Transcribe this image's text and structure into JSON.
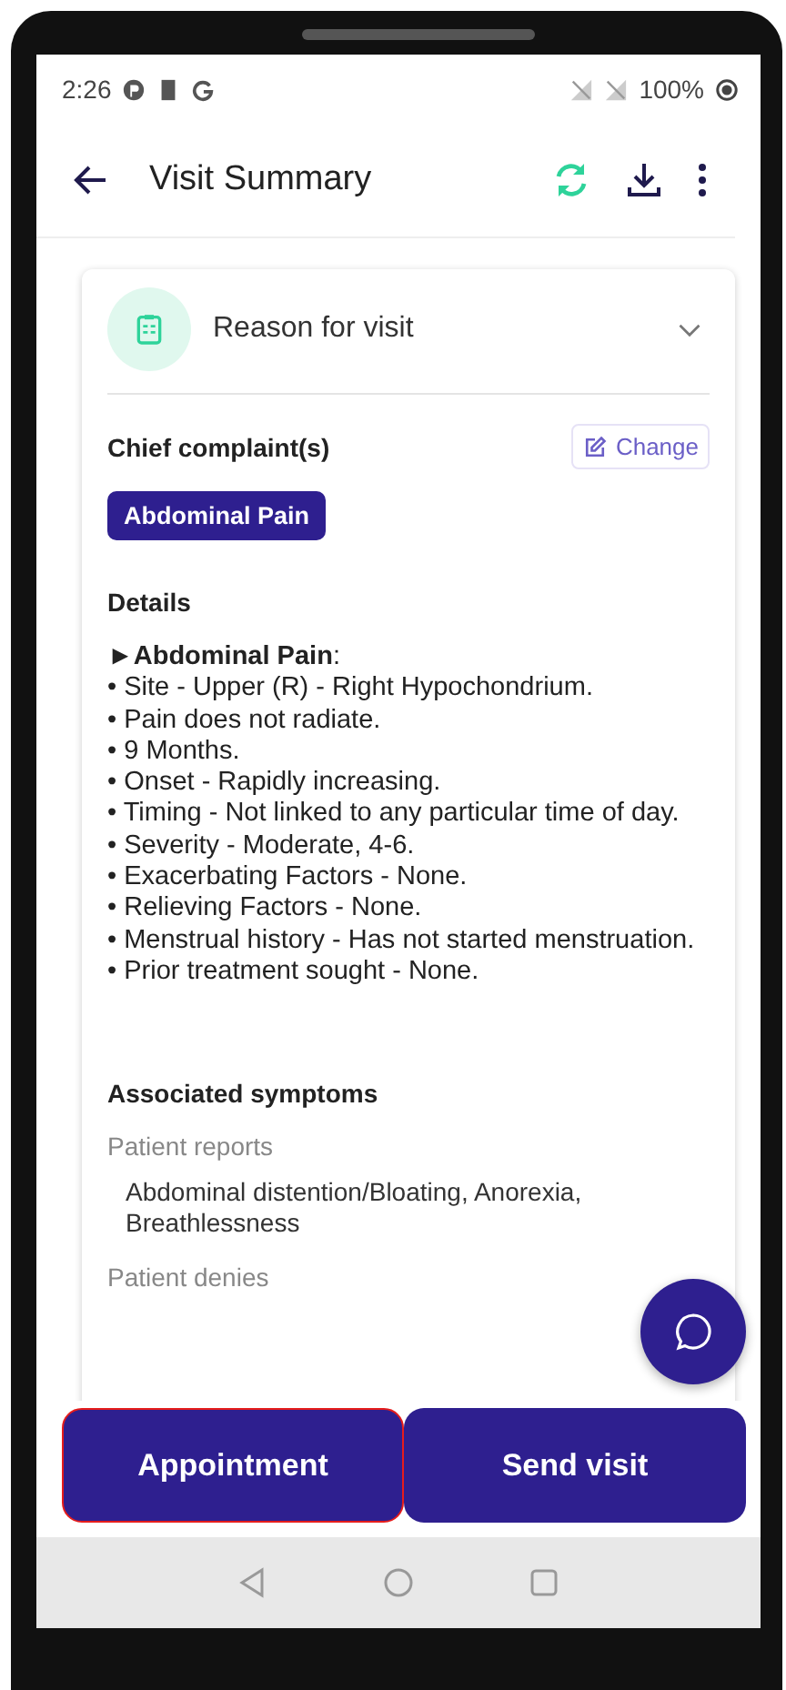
{
  "status_bar": {
    "time": "2:26",
    "battery": "100%"
  },
  "app_bar": {
    "title": "Visit Summary"
  },
  "section": {
    "title": "Reason for visit",
    "expanded": true,
    "chief_complaints": {
      "label": "Chief complaint(s)",
      "action": "Change",
      "tags": [
        "Abdominal Pain"
      ]
    },
    "details": {
      "label": "Details",
      "lines": [
        "►**Abdominal Pain**:",
        "• Site - Upper (R) - Right Hypochondrium.",
        "• Pain does not radiate.",
        "• 9 Months.",
        "• Onset - Rapidly increasing.",
        "• Timing - Not linked to any particular time of day.",
        "• Severity - Moderate, 4-6.",
        "• Exacerbating Factors - None.",
        "• Relieving Factors - None.",
        "• Menstrual history - Has not started menstruation.",
        "• Prior treatment sought - None."
      ]
    },
    "associated": {
      "label": "Associated symptoms",
      "groups": [
        {
          "label": "Patient reports",
          "text": "Abdominal distention/Bloating, Anorexia, Breathlessness"
        },
        {
          "label": "Patient denies"
        }
      ]
    }
  },
  "buttons": [
    {
      "label": "Appointment",
      "highlighted": true
    },
    {
      "label": "Send visit",
      "highlighted": false
    }
  ]
}
